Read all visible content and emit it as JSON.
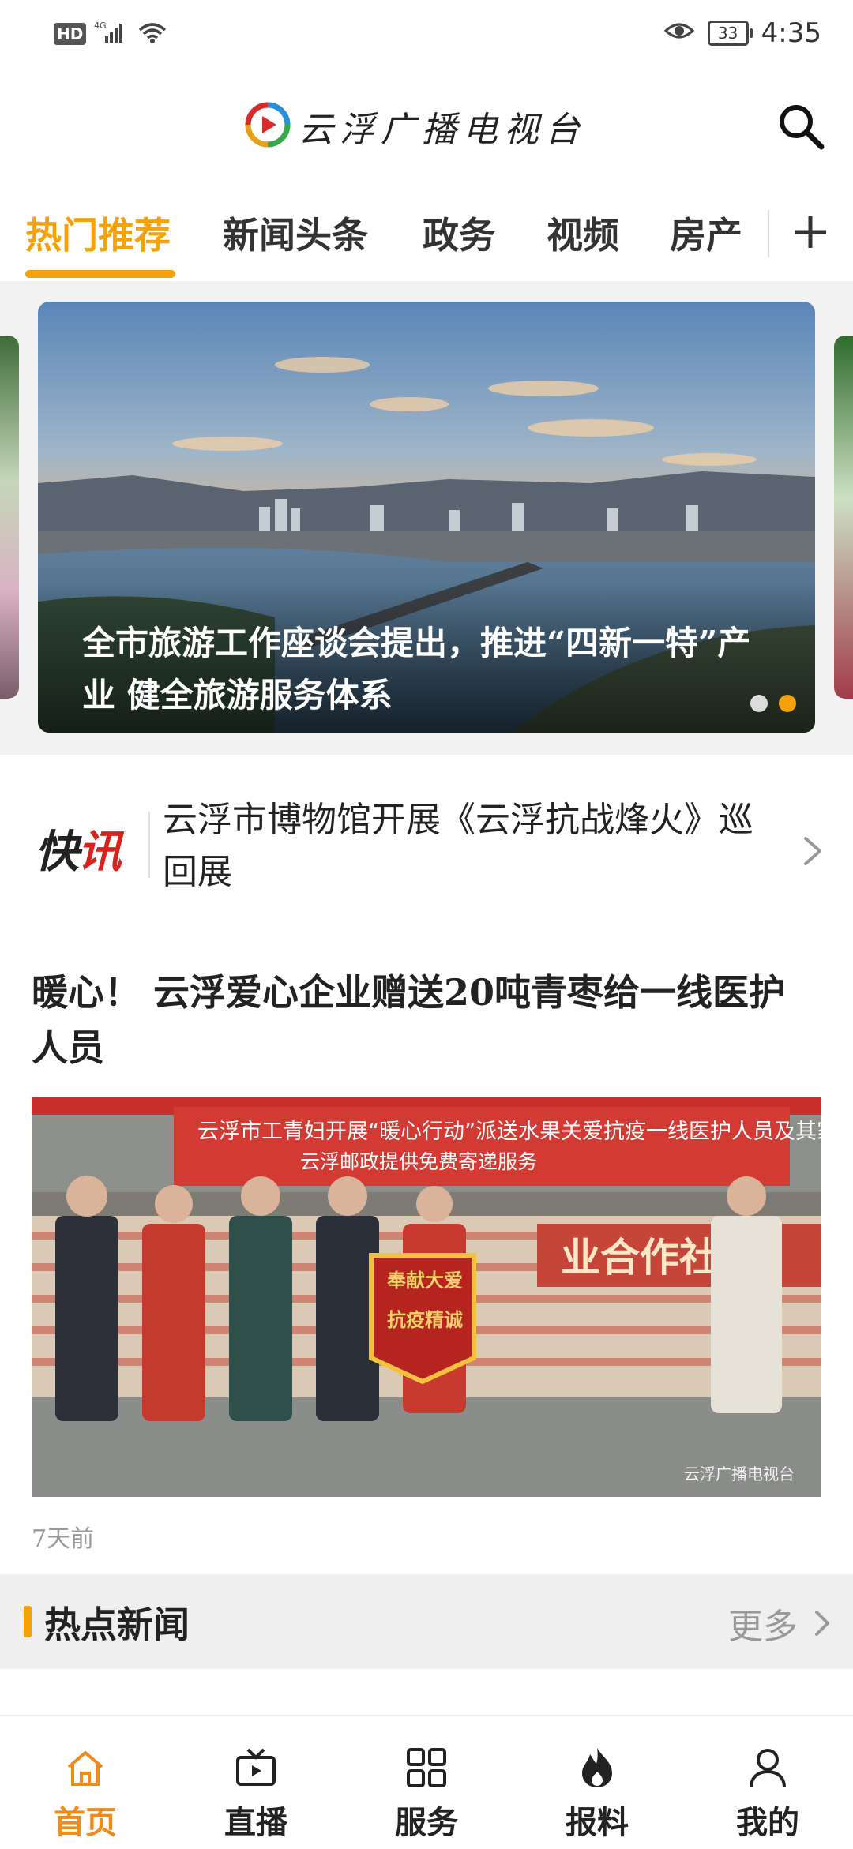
{
  "status_bar": {
    "left": {
      "hd": "HD",
      "network": "4G"
    },
    "time": "4:35",
    "battery": "33"
  },
  "header": {
    "app_title": "云浮广播电视台"
  },
  "tabs": [
    {
      "label": "热门推荐",
      "active": true
    },
    {
      "label": "新闻头条",
      "active": false
    },
    {
      "label": "政务",
      "active": false
    },
    {
      "label": "视频",
      "active": false
    },
    {
      "label": "房产",
      "active": false
    }
  ],
  "banner": {
    "title": "全市旅游工作座谈会提出，推进“四新一特”产业 健全旅游服务体系",
    "slide_count": 2,
    "active_slide": 2
  },
  "flash_news": {
    "logo_text_a": "快",
    "logo_text_b": "讯",
    "text": "云浮市博物馆开展《云浮抗战烽火》巡回展"
  },
  "article": {
    "title": "暖心！ 云浮爱心企业赠送20吨青枣给一线医护人员",
    "image_banner_line1": "云浮市工青妇开展“暖心行动”派送水果关爱抗疫一线医护人员及其家属",
    "image_banner_line2": "云浮邮政提供免费寄递服务",
    "image_pennant": [
      "抗疫精诚",
      "奉献大爱"
    ],
    "image_wall_text": "业合作社联",
    "image_watermark": "云浮广播电视台",
    "time": "7天前"
  },
  "hot_news": {
    "title": "热点新闻",
    "more": "更多"
  },
  "bottom_nav": [
    {
      "label": "首页",
      "icon": "home-icon",
      "active": true
    },
    {
      "label": "直播",
      "icon": "live-tv-icon",
      "active": false
    },
    {
      "label": "服务",
      "icon": "grid-icon",
      "active": false
    },
    {
      "label": "报料",
      "icon": "fire-icon",
      "active": false
    },
    {
      "label": "我的",
      "icon": "user-icon",
      "active": false
    }
  ],
  "colors": {
    "accent": "#f5a10a",
    "nav_active": "#f08a18",
    "muted": "#999999"
  }
}
